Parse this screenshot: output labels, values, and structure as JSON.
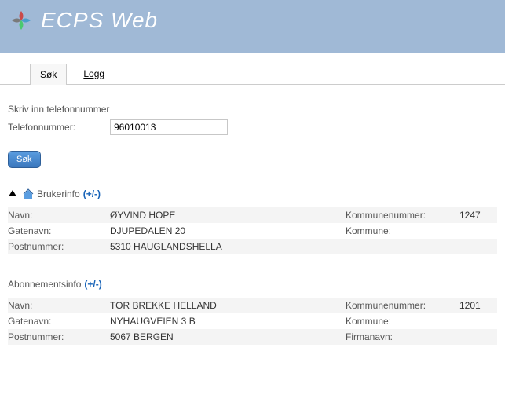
{
  "header": {
    "title": "ECPS Web"
  },
  "tabs": [
    {
      "label": "Søk",
      "active": true
    },
    {
      "label": "Logg",
      "active": false
    }
  ],
  "form": {
    "caption": "Skriv inn telefonnummer",
    "label": "Telefonnummer:",
    "value": "96010013",
    "submit_label": "Søk"
  },
  "sections": {
    "user": {
      "title": "Brukerinfo",
      "toggle": "(+/-)",
      "rows": [
        {
          "label": "Navn:",
          "value": "ØYVIND HOPE",
          "label2": "Kommunenummer:",
          "value2": "1247"
        },
        {
          "label": "Gatenavn:",
          "value": "DJUPEDALEN 20",
          "label2": "Kommune:",
          "value2": ""
        },
        {
          "label": "Postnummer:",
          "value": "5310 HAUGLANDSHELLA",
          "label2": "",
          "value2": ""
        }
      ]
    },
    "subscription": {
      "title": "Abonnementsinfo",
      "toggle": "(+/-)",
      "rows": [
        {
          "label": "Navn:",
          "value": "TOR BREKKE HELLAND",
          "label2": "Kommunenummer:",
          "value2": "1201"
        },
        {
          "label": "Gatenavn:",
          "value": "NYHAUGVEIEN 3 B",
          "label2": "Kommune:",
          "value2": ""
        },
        {
          "label": "Postnummer:",
          "value": "5067 BERGEN",
          "label2": "Firmanavn:",
          "value2": ""
        }
      ]
    }
  }
}
